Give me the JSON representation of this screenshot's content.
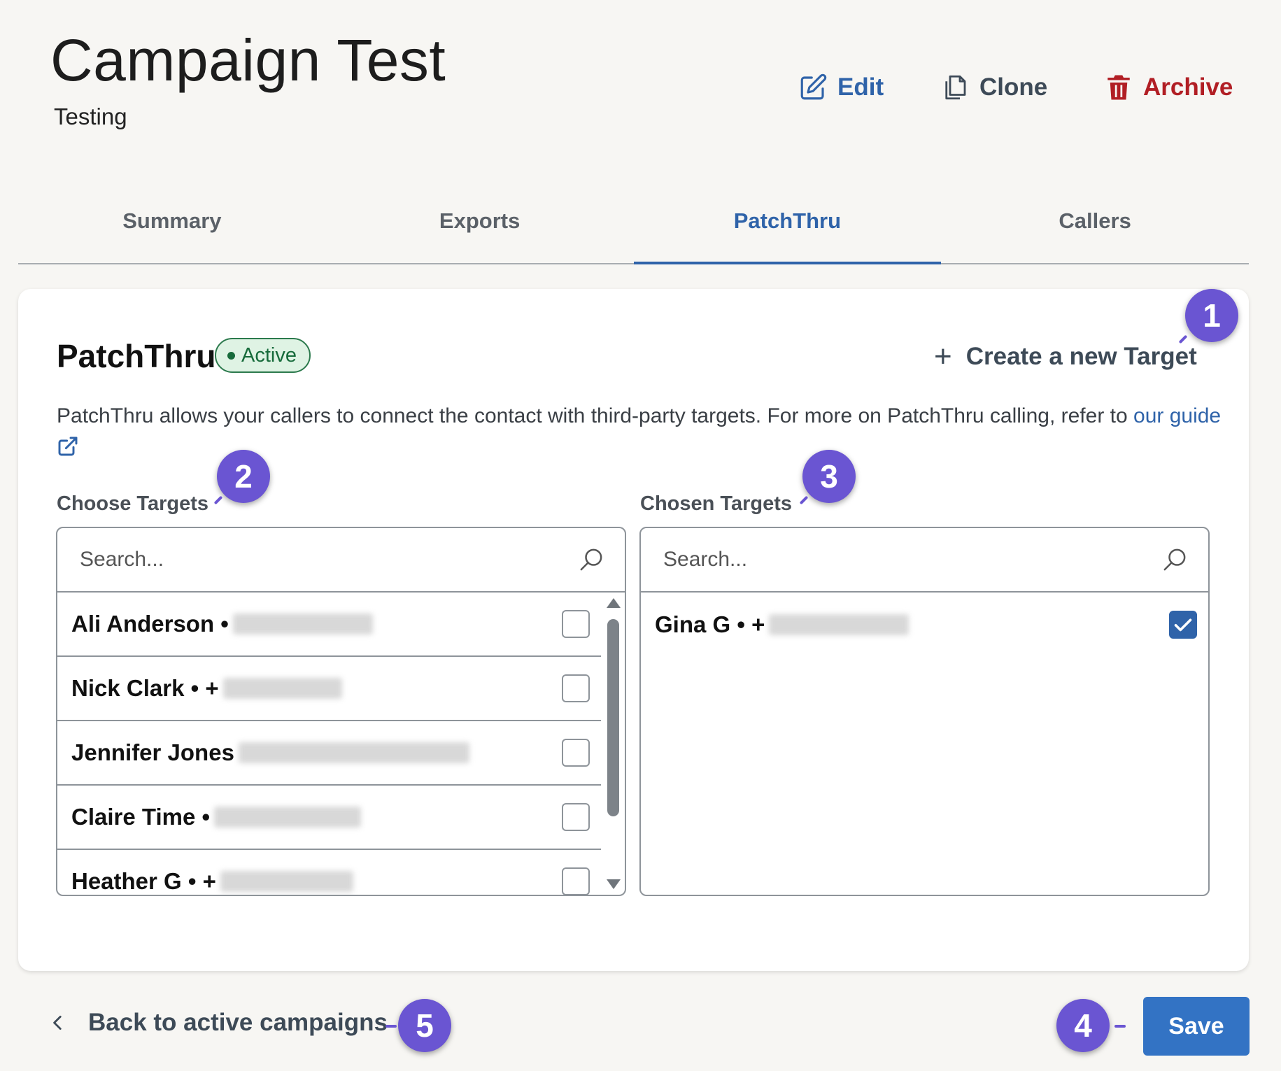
{
  "header": {
    "title": "Campaign Test",
    "subtitle": "Testing",
    "actions": {
      "edit": "Edit",
      "clone": "Clone",
      "archive": "Archive"
    }
  },
  "tabs": [
    {
      "label": "Summary"
    },
    {
      "label": "Exports"
    },
    {
      "label": "PatchThru",
      "active": true
    },
    {
      "label": "Callers"
    }
  ],
  "card": {
    "title": "PatchThru",
    "status_badge": "Active",
    "create_target": "Create a new Target",
    "description": "PatchThru allows your callers to connect the contact with third-party targets. For more on PatchThru calling, refer to ",
    "guide_link": "our guide",
    "choose_label": "Choose Targets",
    "chosen_label": "Chosen Targets",
    "search_placeholder": "Search..."
  },
  "choose_targets": [
    {
      "name": "Ali Anderson •",
      "checked": false
    },
    {
      "name": "Nick Clark • +",
      "checked": false
    },
    {
      "name": "Jennifer Jones",
      "checked": false
    },
    {
      "name": "Claire Time •",
      "checked": false
    },
    {
      "name": "Heather G • +",
      "checked": false
    }
  ],
  "chosen_targets": [
    {
      "name": "Gina G • +",
      "checked": true
    }
  ],
  "footer": {
    "back_label": "Back to active campaigns",
    "save_label": "Save"
  },
  "callouts": {
    "c1": "1",
    "c2": "2",
    "c3": "3",
    "c4": "4",
    "c5": "5"
  },
  "colors": {
    "accent": "#2f63a9",
    "danger": "#b11e24",
    "success": "#176b3b",
    "callout": "#6a55d2",
    "save_button": "#3373c4"
  },
  "icons": {
    "edit": "pencil-square-icon",
    "clone": "copy-icon",
    "archive": "trash-icon",
    "create": "plus-icon",
    "external": "external-link-icon",
    "search": "search-icon",
    "back": "chevron-left-icon",
    "checkbox": "checkmark-icon"
  }
}
